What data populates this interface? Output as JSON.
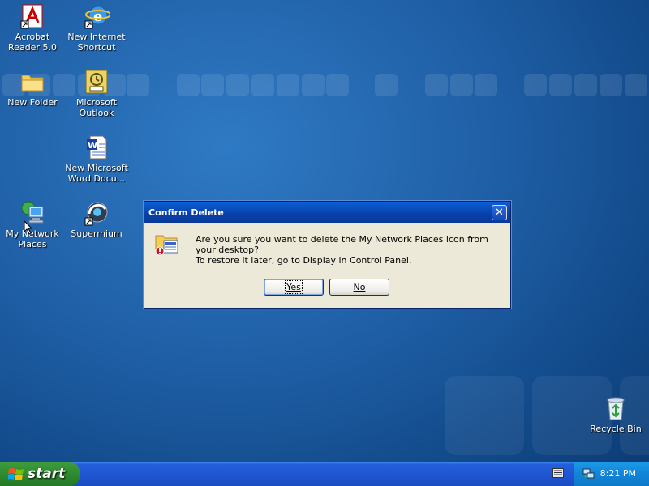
{
  "desktop": {
    "icons": [
      {
        "label": "Acrobat Reader 5.0",
        "icon": "acrobat-icon"
      },
      {
        "label": "New Internet Shortcut",
        "icon": "internet-explorer-icon"
      },
      {
        "label": "New Folder",
        "icon": "folder-icon"
      },
      {
        "label": "Microsoft Outlook",
        "icon": "outlook-icon"
      },
      {
        "label": "New Microsoft Word Docu...",
        "icon": "word-document-icon"
      },
      {
        "label": "My Network Places",
        "icon": "network-places-icon"
      },
      {
        "label": "Supermium",
        "icon": "supermium-icon"
      },
      {
        "label": "Recycle Bin",
        "icon": "recycle-bin-icon"
      }
    ]
  },
  "dialog": {
    "title": "Confirm Delete",
    "message": "Are you sure you want to delete the My Network Places icon from your desktop?",
    "hint": "To restore it later, go to Display in Control Panel.",
    "yes_label": "Yes",
    "no_label": "No",
    "close_glyph": "✕"
  },
  "taskbar": {
    "start_label": "start",
    "clock": "8:21 PM"
  },
  "colors": {
    "desktop_bg": "#1f5fa6",
    "titlebar": "#0840a8",
    "taskbar": "#245edb",
    "start_green": "#2e8b2e"
  }
}
